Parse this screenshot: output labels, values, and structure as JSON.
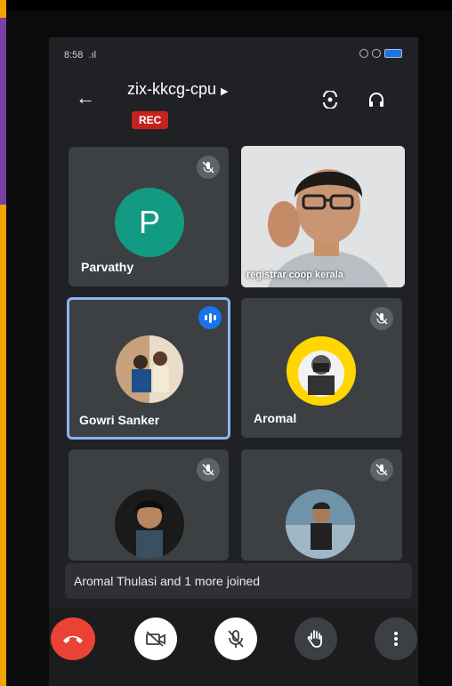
{
  "status": {
    "time": "8:58"
  },
  "meeting": {
    "code": "zix-kkcg-cpu",
    "rec": "REC"
  },
  "participants": [
    {
      "name": "Parvathy",
      "initial": "P"
    },
    {
      "name": "registrar coop kerala"
    },
    {
      "name": "Gowri Sanker"
    },
    {
      "name": "Aromal"
    },
    {
      "name": ""
    },
    {
      "name": ""
    }
  ],
  "toast": {
    "message": "Aromal Thulasi and 1 more joined"
  },
  "colors": {
    "rec": "#c5221f",
    "hangup": "#ea4335",
    "speaking": "#1a73e8",
    "avatar_p": "#129b82"
  }
}
